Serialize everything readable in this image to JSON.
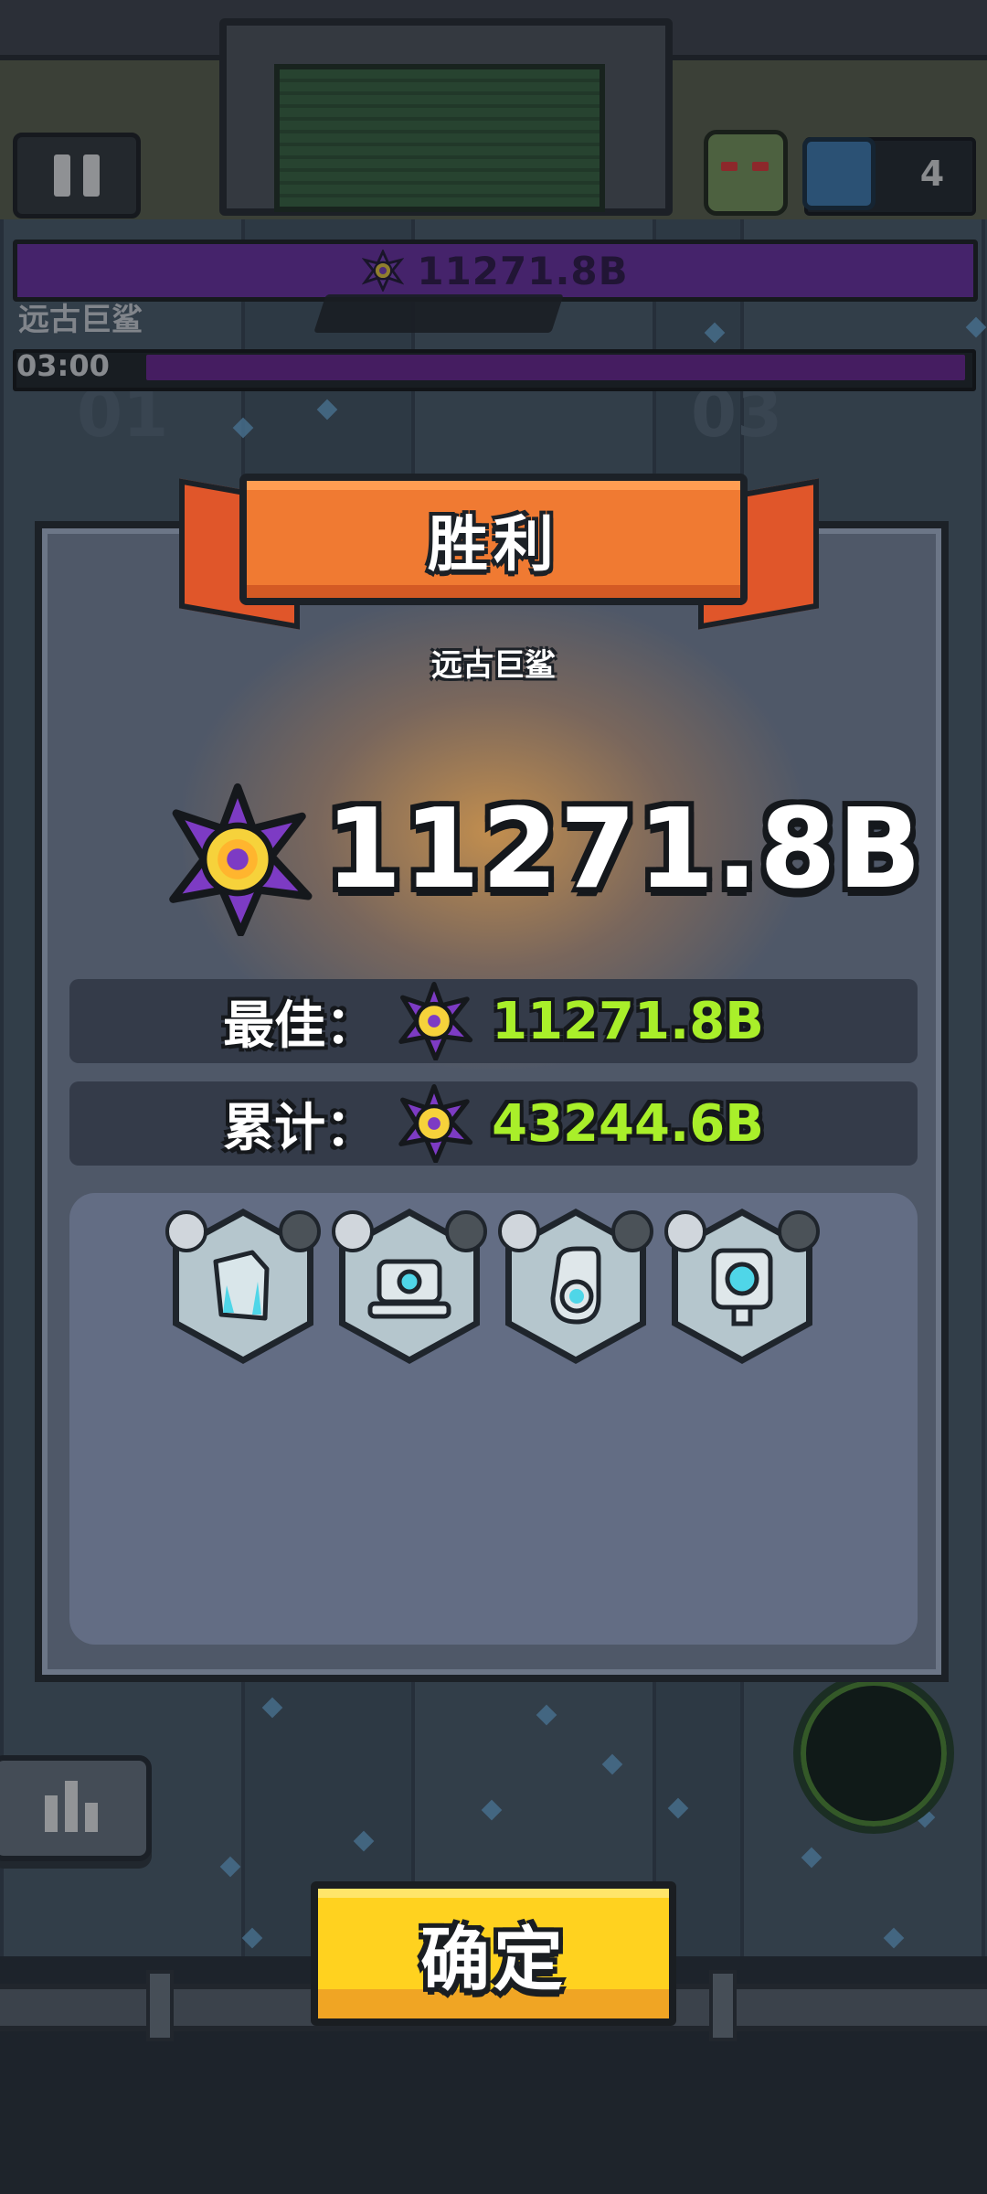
{
  "hud": {
    "boss_hp": "11271.8B",
    "boss_name": "远古巨鲨",
    "timer": "03:00",
    "chest_count": "4",
    "lane_numbers": [
      "01",
      "03"
    ]
  },
  "result": {
    "title": "胜利",
    "boss_name": "远古巨鲨",
    "score": "11271.8B",
    "best_label": "最佳：",
    "best_value": "11271.8B",
    "total_label": "累计：",
    "total_value": "43244.6B",
    "items": [
      {
        "name": "crystal-shard",
        "left_badge": "shield-icon",
        "right_badge": "rocket-icon"
      },
      {
        "name": "laptop-turret",
        "left_badge": "crown-icon",
        "right_badge": "drill-icon"
      },
      {
        "name": "cannon-turret",
        "left_badge": "crown-icon",
        "right_badge": "gun-icon"
      },
      {
        "name": "camera-turret",
        "left_badge": "shield-icon",
        "right_badge": "dome-icon"
      }
    ]
  },
  "buttons": {
    "confirm": "确定"
  },
  "colors": {
    "ribbon": "#f07a32",
    "score_green": "#a9ef2a",
    "confirm_yellow": "#ffd21f",
    "boss_bar_purple": "#6c2aa8"
  }
}
